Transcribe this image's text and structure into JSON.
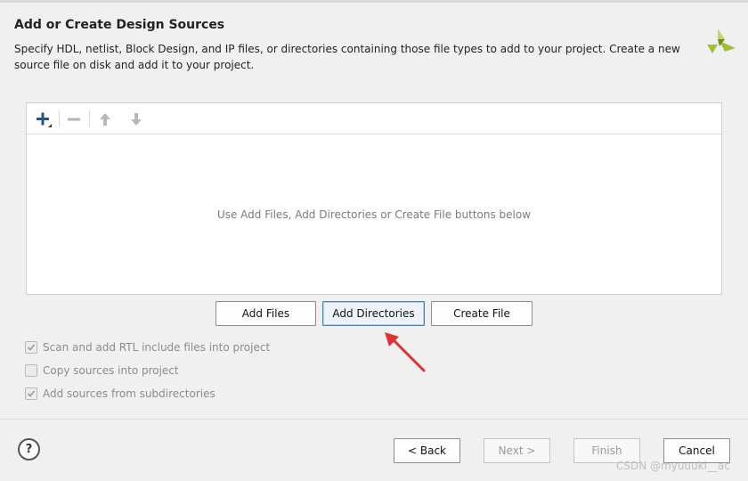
{
  "header": {
    "title": "Add or Create Design Sources",
    "description": "Specify HDL, netlist, Block Design, and IP files, or directories containing those file types to add to your project. Create a new source file on disk and add it to your project."
  },
  "toolbar": {
    "add_icon": "plus-icon",
    "remove_icon": "minus-icon",
    "up_icon": "arrow-up-icon",
    "down_icon": "arrow-down-icon"
  },
  "panel": {
    "empty_message": "Use Add Files, Add Directories or Create File buttons below"
  },
  "actions": {
    "add_files": "Add Files",
    "add_directories": "Add Directories",
    "create_file": "Create File"
  },
  "options": [
    {
      "label": "Scan and add RTL include files into project",
      "checked": true
    },
    {
      "label": "Copy sources into project",
      "checked": false
    },
    {
      "label": "Add sources from subdirectories",
      "checked": true
    }
  ],
  "footer": {
    "help": "?",
    "back": "< Back",
    "next": "Next >",
    "finish": "Finish",
    "cancel": "Cancel"
  },
  "watermark": "CSDN @myuuuki__ac",
  "colors": {
    "accent": "#4a7ebb",
    "logo_green": "#a3be3a",
    "annotation_red": "#e03232"
  }
}
